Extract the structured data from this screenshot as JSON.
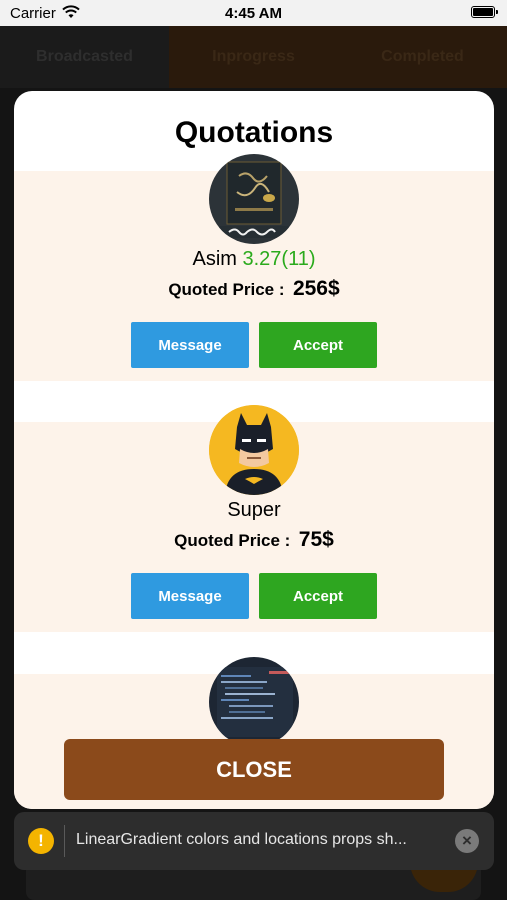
{
  "status_bar": {
    "carrier": "Carrier",
    "time": "4:45 AM"
  },
  "tabs": [
    {
      "label": "Broadcasted",
      "active": true
    },
    {
      "label": "Inprogress",
      "active": false
    },
    {
      "label": "Completed",
      "active": false
    }
  ],
  "modal": {
    "title": "Quotations",
    "quotes": [
      {
        "name": "Asim",
        "rating": "3.27(11)",
        "price_label": "Quoted Price :",
        "price": "256$",
        "message_label": "Message",
        "accept_label": "Accept",
        "avatar": "calligraphy-avatar"
      },
      {
        "name": "Super",
        "rating": "",
        "price_label": "Quoted Price :",
        "price": "75$",
        "message_label": "Message",
        "accept_label": "Accept",
        "avatar": "batman-avatar"
      },
      {
        "avatar": "code-screen-avatar"
      }
    ],
    "close_label": "CLOSE"
  },
  "toast": {
    "text": "LinearGradient colors and locations props sh...",
    "icon": "!",
    "close_icon": "×"
  },
  "colors": {
    "message_button": "#2f9ae0",
    "accept_button": "#2ea620",
    "close_button": "#8b4a1b",
    "rating": "#2aaa1c",
    "card_bg": "#fdf3ea"
  }
}
